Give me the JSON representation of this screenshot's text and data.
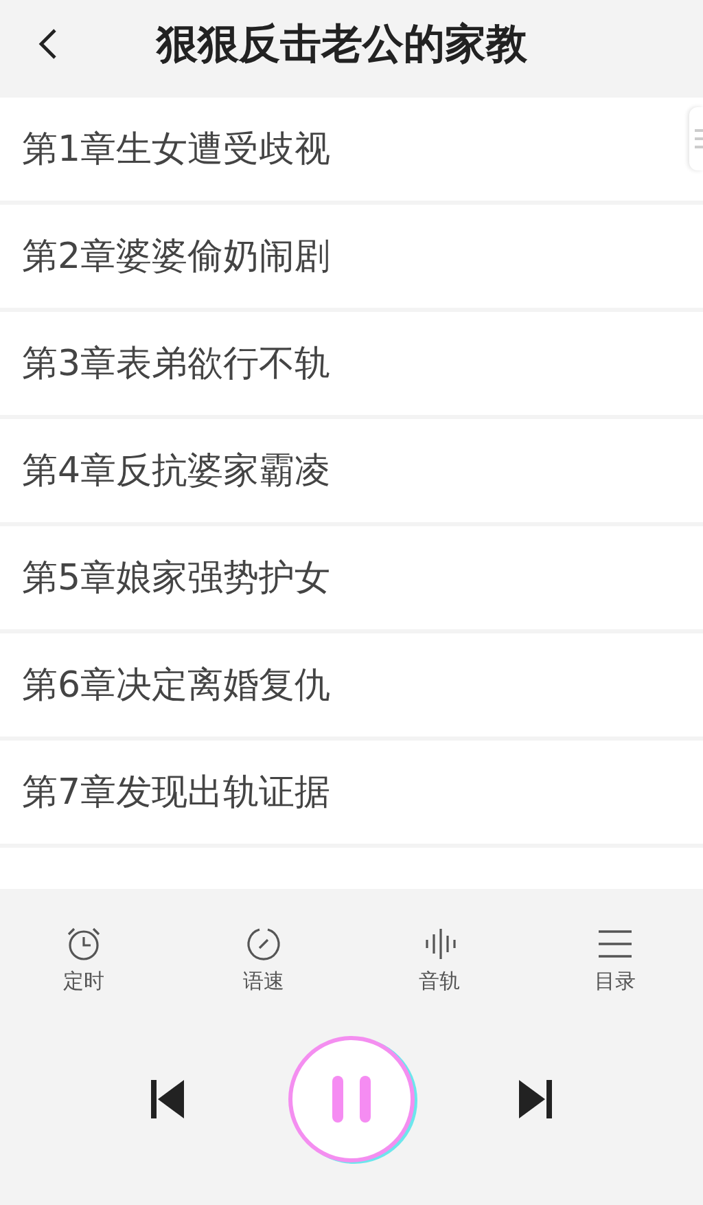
{
  "header": {
    "title": "狠狠反击老公的家教"
  },
  "chapters": [
    {
      "title": "第1章生女遭受歧视"
    },
    {
      "title": "第2章婆婆偷奶闹剧"
    },
    {
      "title": "第3章表弟欲行不轨"
    },
    {
      "title": "第4章反抗婆家霸凌"
    },
    {
      "title": "第5章娘家强势护女"
    },
    {
      "title": "第6章决定离婚复仇"
    },
    {
      "title": "第7章发现出轨证据"
    }
  ],
  "toolbar": [
    {
      "kind": "timer",
      "label": "定时"
    },
    {
      "kind": "speed",
      "label": "语速"
    },
    {
      "kind": "track",
      "label": "音轨"
    },
    {
      "kind": "contents",
      "label": "目录"
    }
  ],
  "player": {
    "playing": true
  }
}
